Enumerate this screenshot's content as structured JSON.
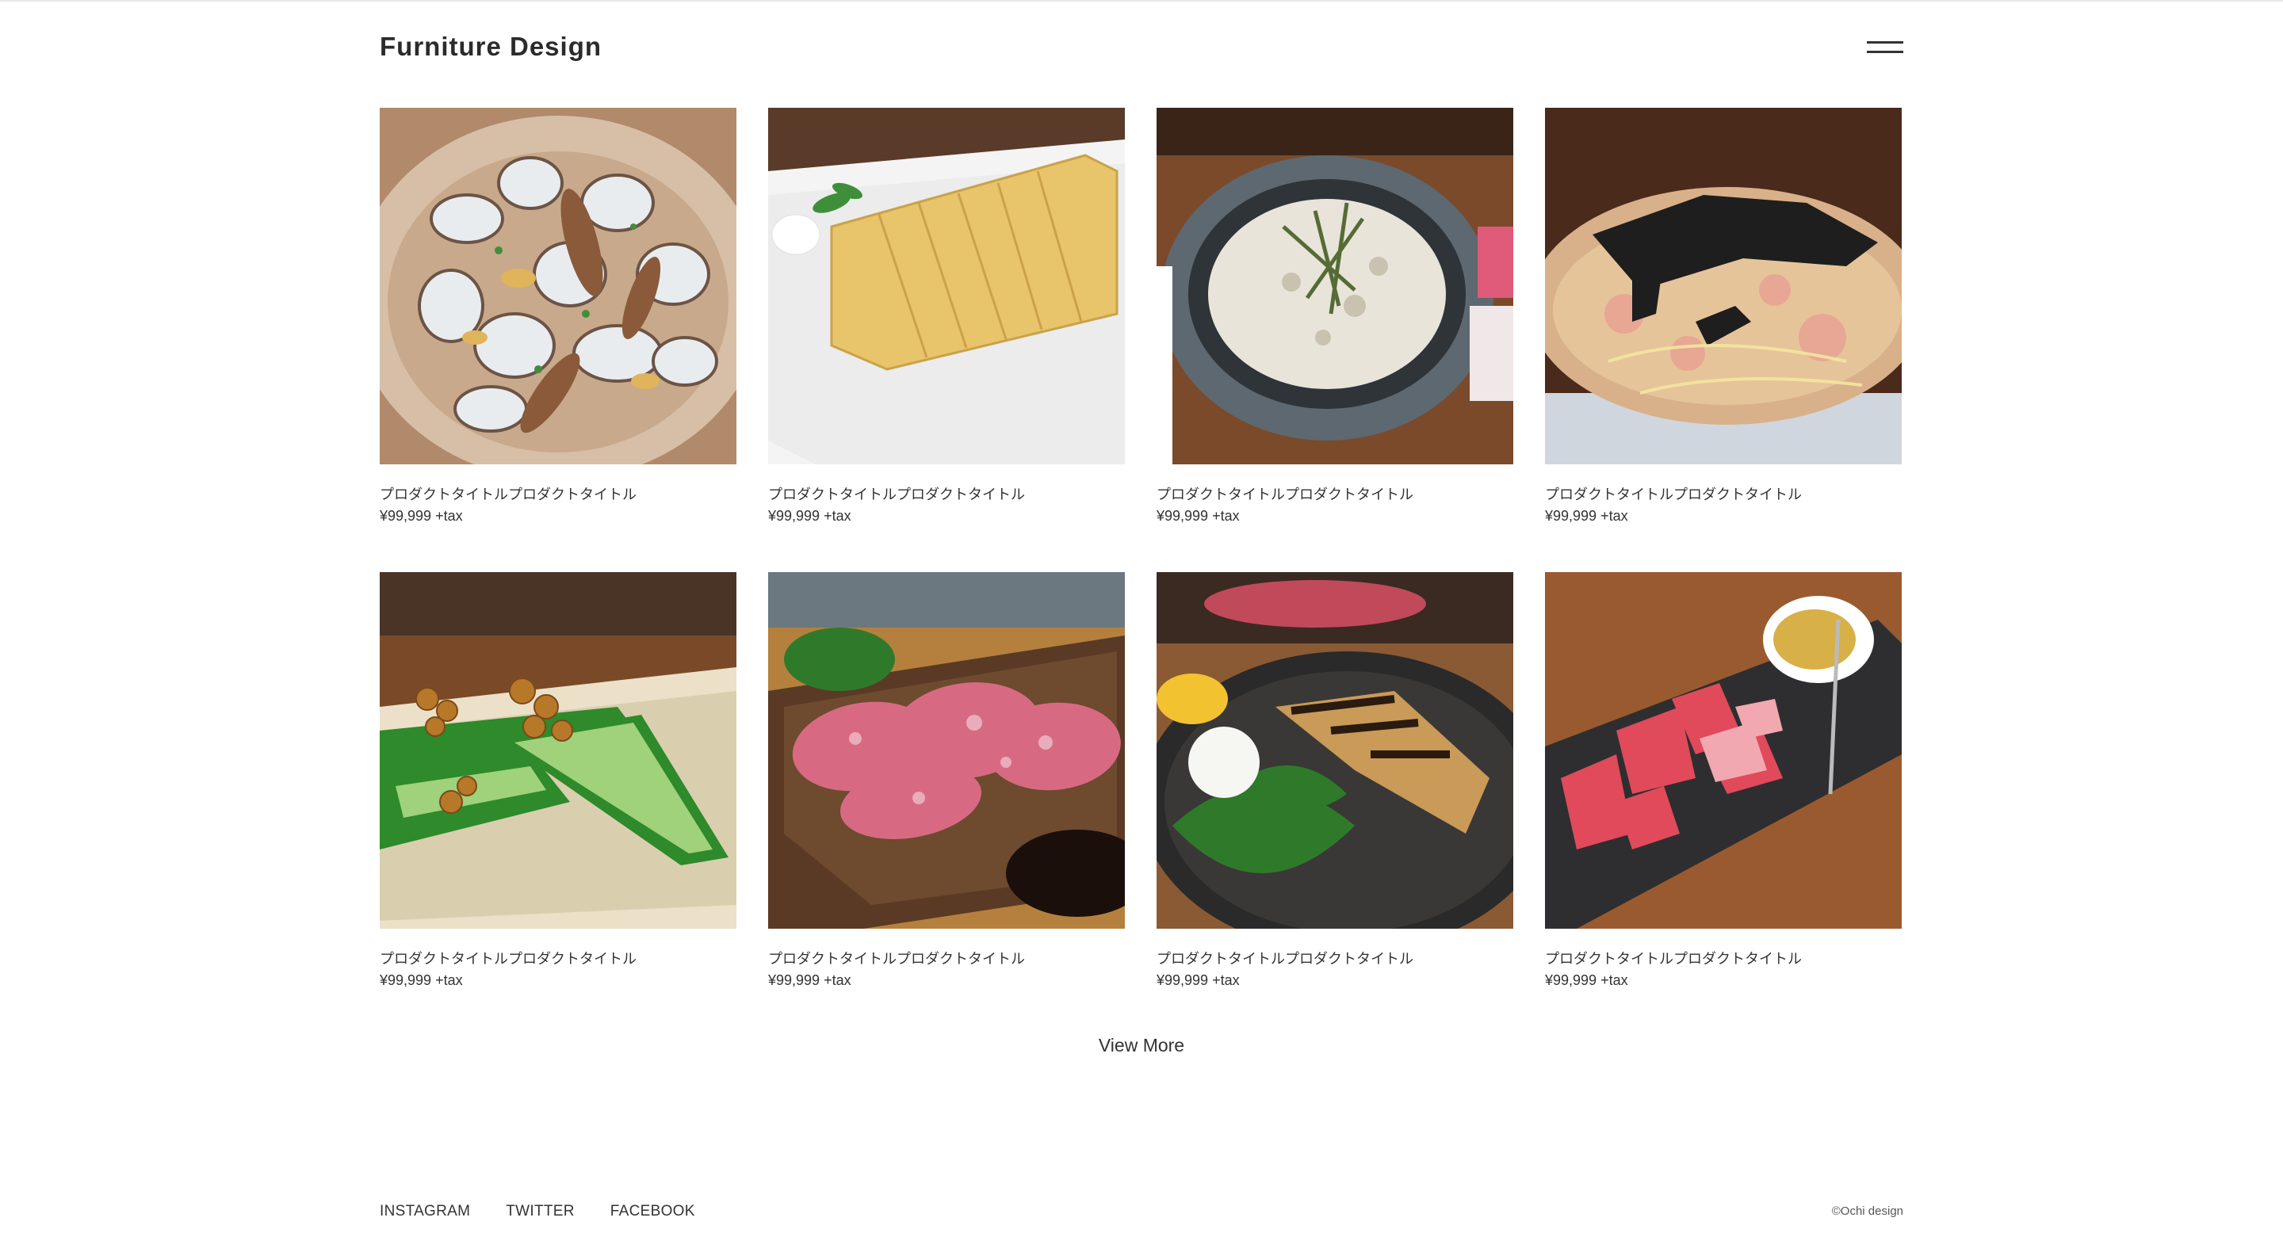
{
  "header": {
    "logo": "Furniture Design",
    "menu_icon": "hamburger-menu-icon"
  },
  "products": [
    {
      "title": "プロダクトタイトルプロダクトタイトル",
      "price": "¥99,999 +tax",
      "image": "steamed clams dish"
    },
    {
      "title": "プロダクトタイトルプロダクトタイトル",
      "price": "¥99,999 +tax",
      "image": "rolled omelette on white plate"
    },
    {
      "title": "プロダクトタイトルプロダクトタイトル",
      "price": "¥99,999 +tax",
      "image": "whitebait rice bowl with seaweed"
    },
    {
      "title": "プロダクトタイトルプロダクトタイトル",
      "price": "¥99,999 +tax",
      "image": "okonomiyaki with nori and bonito"
    },
    {
      "title": "プロダクトタイトルプロダクトタイトル",
      "price": "¥99,999 +tax",
      "image": "cucumber with natto-style topping"
    },
    {
      "title": "プロダクトタイトルプロダクトタイトル",
      "price": "¥99,999 +tax",
      "image": "marbled raw beef with shiso"
    },
    {
      "title": "プロダクトタイトルプロダクトタイトル",
      "price": "¥99,999 +tax",
      "image": "grilled fish collar with lemon"
    },
    {
      "title": "プロダクトタイトルプロダクトタイトル",
      "price": "¥99,999 +tax",
      "image": "raw meat slices on slate"
    }
  ],
  "view_more": "View More",
  "footer": {
    "links": [
      "INSTAGRAM",
      "TWITTER",
      "FACEBOOK"
    ],
    "copyright": "©Ochi design"
  }
}
